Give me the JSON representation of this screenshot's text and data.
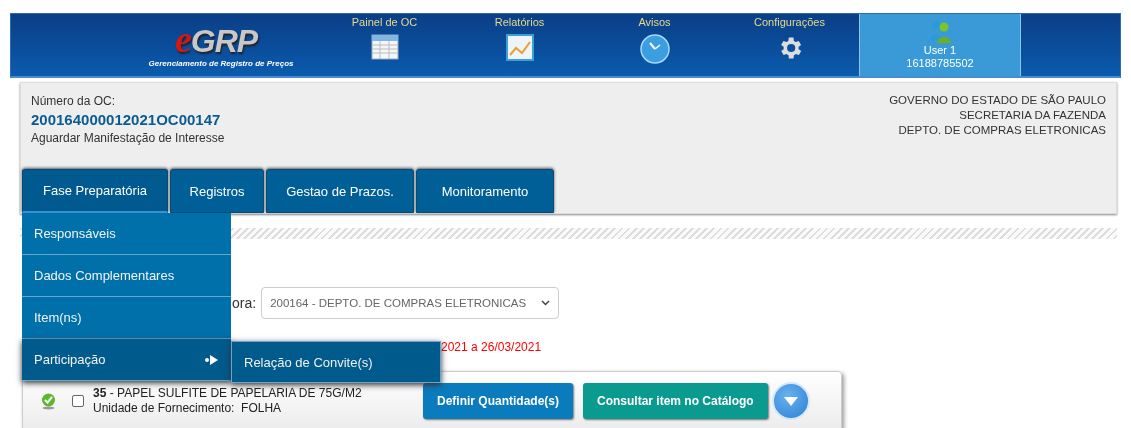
{
  "header": {
    "logo": {
      "initial": "e",
      "text": "GRP",
      "tagline": "Gerenciamento de Registro de Preços"
    },
    "nav": [
      {
        "label": "Painel de OC",
        "kind": "table"
      },
      {
        "label": "Relatórios",
        "kind": "chart"
      },
      {
        "label": "Avisos",
        "kind": "clock"
      },
      {
        "label": "Configurações",
        "kind": "gear"
      }
    ],
    "user": {
      "name": "User 1",
      "id": "16188785502"
    }
  },
  "oc": {
    "label": "Número da OC:",
    "number": "200164000012021OC00147",
    "status": "Aguardar Manifestação de Interesse"
  },
  "agency": [
    "GOVERNO DO ESTADO DE SÃO PAULO",
    "SECRETARIA DA FAZENDA",
    "DEPTO. DE COMPRAS ELETRONICAS"
  ],
  "tabs": [
    {
      "label": "Fase Preparatória",
      "expanded": true,
      "menu": [
        {
          "label": "Responsáveis",
          "selected": false
        },
        {
          "label": "Dados Complementares",
          "selected": false
        },
        {
          "label": "Item(ns)",
          "selected": false
        },
        {
          "label": "Participação",
          "selected": true,
          "submenu": [
            "Relação de Convite(s)"
          ]
        }
      ]
    },
    {
      "label": "Registros",
      "expanded": false
    },
    {
      "label": "Gestao de Prazos.",
      "expanded": false
    },
    {
      "label": "Monitoramento",
      "expanded": false
    }
  ],
  "filter": {
    "label": "ora:",
    "value": "200164 - DEPTO. DE COMPRAS ELETRONICAS"
  },
  "period_note": "2021 a 26/03/2021",
  "items": [
    {
      "approved": true,
      "checked": false,
      "title": "**35** - PAPEL SULFITE DE PAPELARIA DE 75G/M2",
      "unit_label": "Unidade de Fornecimento:",
      "unit": "FOLHA",
      "buttons": [
        {
          "label": "Definir Quantidade(s)",
          "kind": "primary"
        },
        {
          "label": "Consultar item no Catálogo",
          "kind": "secondary"
        }
      ]
    }
  ]
}
